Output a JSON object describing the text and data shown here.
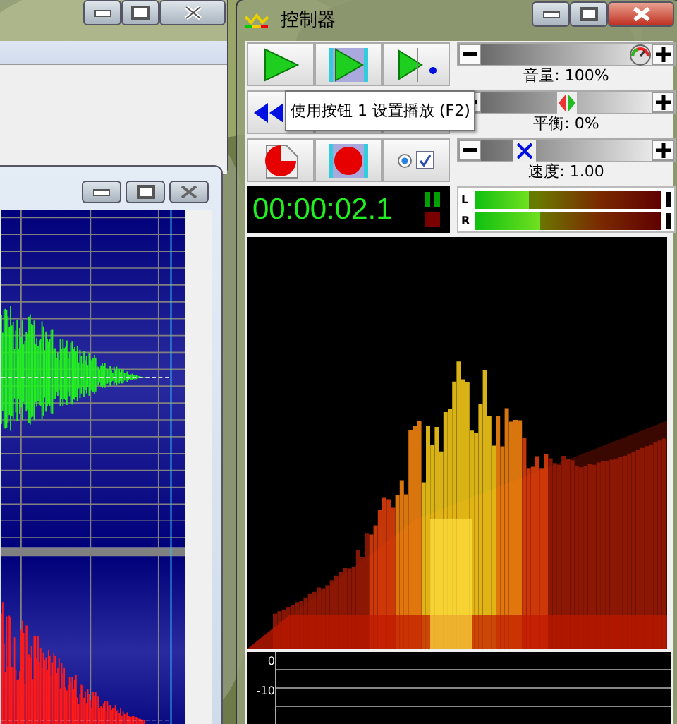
{
  "controller": {
    "title": "控制器",
    "tooltip": "使用按钮 1 设置播放 (F2)",
    "options": {
      "radio_selected": true,
      "checked": true
    },
    "sliders": [
      {
        "kind": "volume",
        "label": "音量: 100%",
        "level": 1
      },
      {
        "kind": "balance",
        "label": "平衡: 0%",
        "level": 0.5
      },
      {
        "kind": "speed",
        "label": "速度: 1.00",
        "level": 0.22
      }
    ],
    "time": "00:00:02.1",
    "meter": {
      "channels": [
        {
          "label": "L",
          "level": 0.29
        },
        {
          "label": "R",
          "level": 0.35
        }
      ]
    },
    "scope": {
      "ticks": [
        "0",
        "-10"
      ]
    }
  }
}
